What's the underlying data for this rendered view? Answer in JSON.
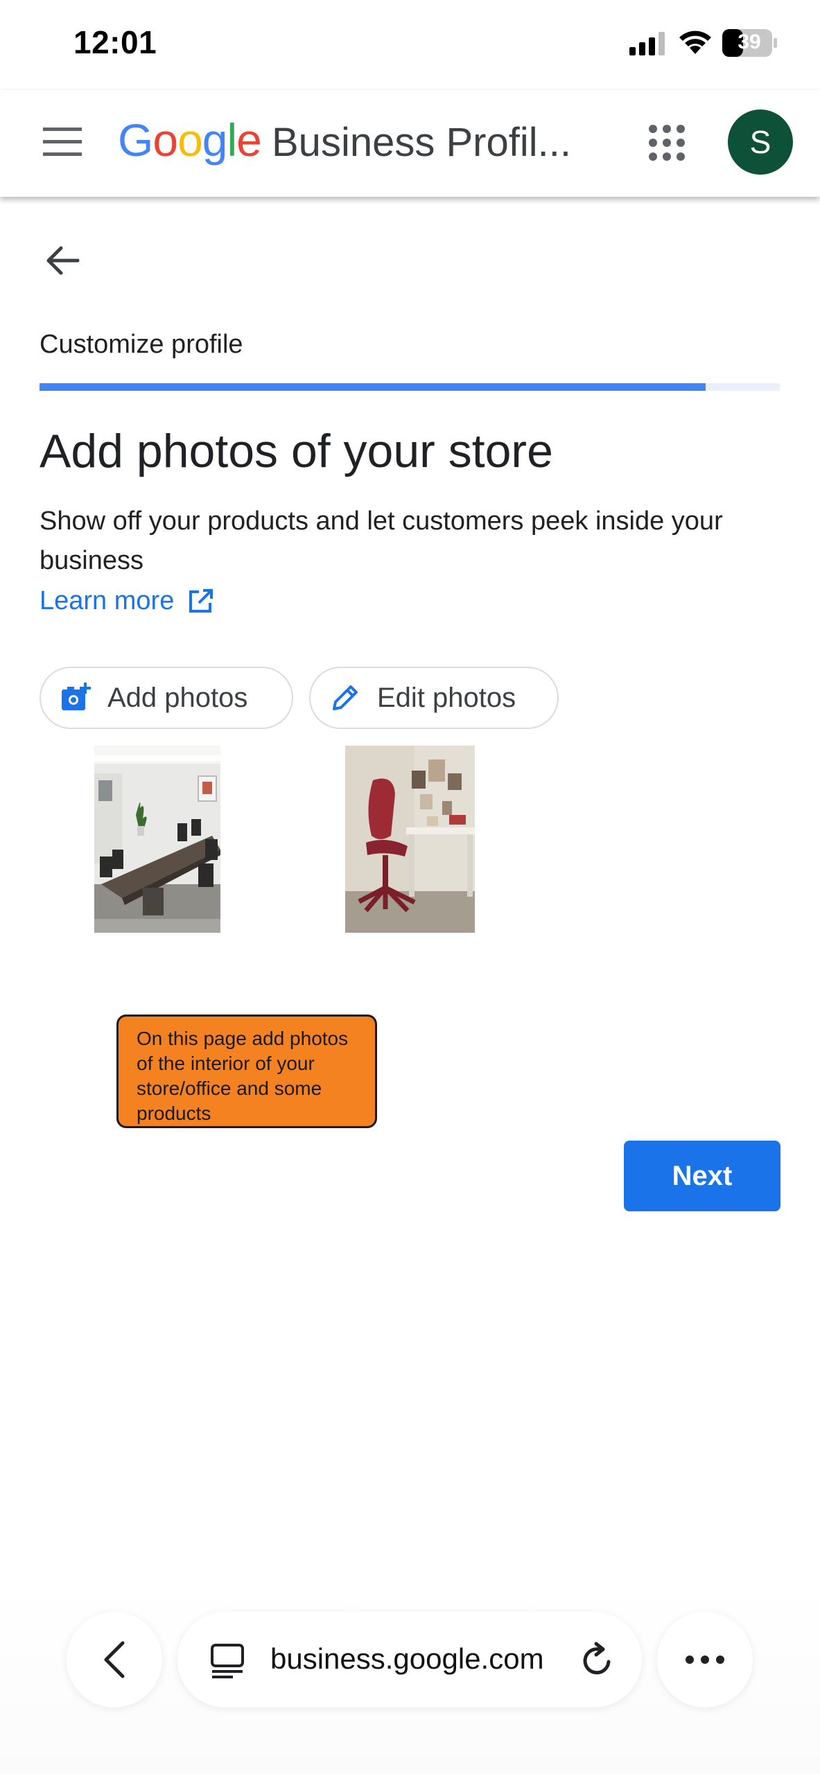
{
  "status_bar": {
    "time": "12:01",
    "battery": "39"
  },
  "app_bar": {
    "logo_letters": [
      "G",
      "o",
      "o",
      "g",
      "l",
      "e"
    ],
    "logo_colors": [
      "#4285f4",
      "#ea4335",
      "#fbbc05",
      "#4285f4",
      "#34a853",
      "#ea4335"
    ],
    "product": "Business Profil...",
    "avatar_letter": "S"
  },
  "content": {
    "section_title": "Customize profile",
    "progress": 0.9,
    "page_title": "Add photos of your store",
    "description": "Show off your products and let customers peek inside your business",
    "learn_more": "Learn more",
    "add_photos_label": "Add photos",
    "edit_photos_label": "Edit photos",
    "photos": [
      "conference-room-photo",
      "office-chair-photo"
    ],
    "note": "On this page add photos of the interior of your store/office and some products",
    "next_label": "Next"
  },
  "browser": {
    "url": "business.google.com"
  },
  "colors": {
    "accent": "#1a73e8",
    "avatar_bg": "#0d5238",
    "note_bg": "#f58220"
  }
}
